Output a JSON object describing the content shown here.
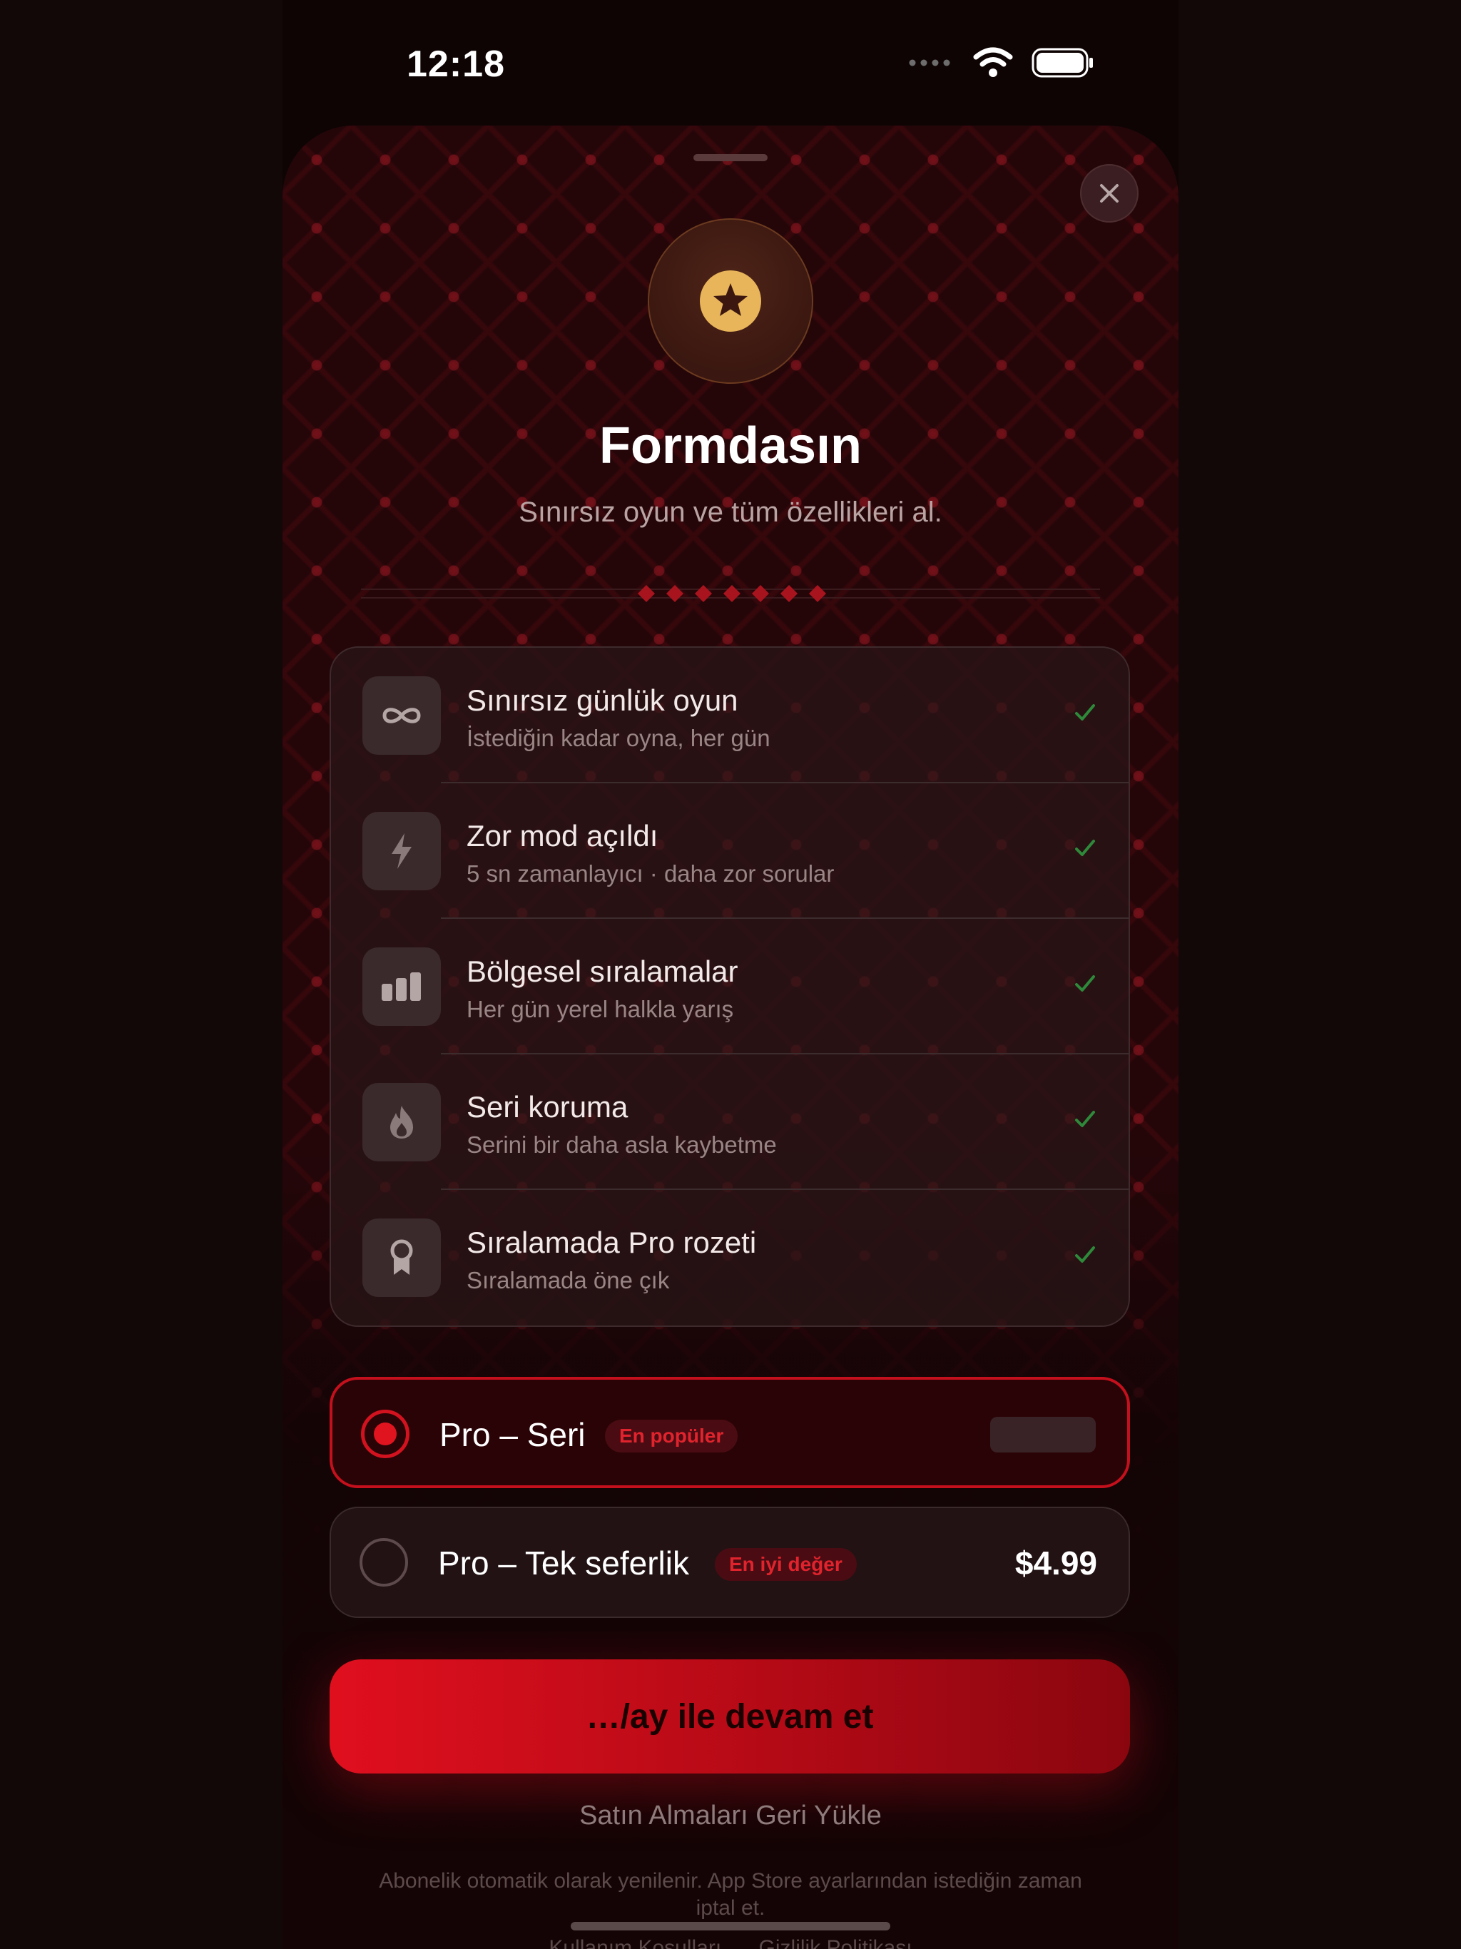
{
  "status_bar": {
    "time": "12:18"
  },
  "paywall": {
    "title": "Formdasın",
    "subtitle": "Sınırsız oyun ve tüm özellikleri al.",
    "features": [
      {
        "icon": "infinity-icon",
        "title": "Sınırsız günlük oyun",
        "subtitle": "İstediğin kadar oyna, her gün"
      },
      {
        "icon": "bolt-icon",
        "title": "Zor mod açıldı",
        "subtitle": "5 sn zamanlayıcı · daha zor sorular"
      },
      {
        "icon": "bar-chart-icon",
        "title": "Bölgesel sıralamalar",
        "subtitle": "Her gün yerel halkla yarış"
      },
      {
        "icon": "flame-icon",
        "title": "Seri koruma",
        "subtitle": "Serini bir daha asla kaybetme"
      },
      {
        "icon": "award-ribbon-icon",
        "title": "Sıralamada Pro rozeti",
        "subtitle": "Sıralamada öne çık"
      }
    ],
    "plans": [
      {
        "name": "Pro – Seri",
        "tag": "En popüler",
        "price": "",
        "selected": true
      },
      {
        "name": "Pro – Tek seferlik",
        "tag": "En iyi değer",
        "price": "$4.99",
        "selected": false
      }
    ],
    "cta_label": "…/ay ile devam et",
    "restore_label": "Satın Almaları Geri Yükle",
    "legal_text": "Abonelik otomatik olarak yenilenir. App Store ayarlarından istediğin zaman iptal et.",
    "legal_links": [
      "Kullanım Koşulları",
      "Gizlilik Politikası"
    ]
  },
  "colors": {
    "accent": "#e00f1e",
    "gold": "#e8b55a",
    "check": "#2e8a3a"
  }
}
